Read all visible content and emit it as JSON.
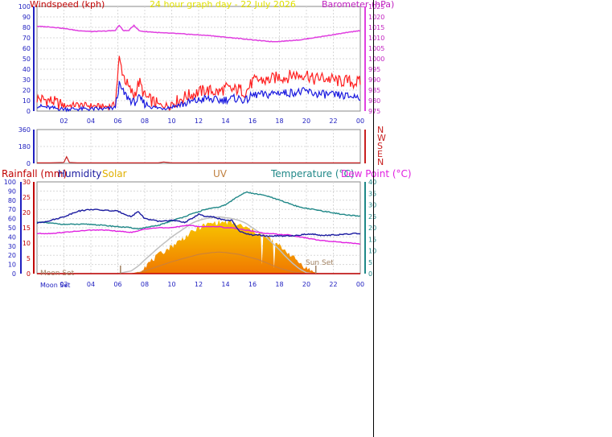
{
  "header": {
    "title": "24 hour graph day - 22 July 2026",
    "windspeed_label": "Windspeed (kph)",
    "barometer_label": "Barometer (hPa)"
  },
  "colors": {
    "wind_gust": "#ff2020",
    "wind_avg": "#1a1adf",
    "barometer": "#e040e0",
    "rainfall": "#c00000",
    "humidity": "#1a1aa0",
    "solar": "#f0c000",
    "uv": "#c88040",
    "temperature": "#208888",
    "dewpoint": "#e020e0",
    "axis_blue": "#2020c0",
    "direction": "#c82020"
  },
  "bottom_legend": {
    "rainfall": "Rainfall (mm)",
    "humidity": "Humidity",
    "solar": "Solar",
    "uv": "UV",
    "temperature": "Temperature (°C)",
    "dewpoint": "Dew Point (°C)"
  },
  "annotations": {
    "moon_set": "Moon Set",
    "sun_set": "Sun Set",
    "moon_set_axis": "Moon Set"
  },
  "direction_labels": [
    "N",
    "W",
    "S",
    "E",
    "N"
  ],
  "chart_data": [
    {
      "type": "line",
      "name": "wind-and-pressure",
      "x_hours": [
        0,
        1,
        2,
        3,
        4,
        5,
        5.8,
        6.1,
        6.4,
        6.8,
        7.2,
        7.6,
        8,
        8.5,
        9,
        9.5,
        10,
        10.5,
        11,
        11.5,
        12,
        12.5,
        13,
        13.5,
        14,
        14.5,
        15,
        15.5,
        16,
        16.5,
        17,
        17.5,
        18,
        18.5,
        19,
        19.5,
        20,
        20.5,
        21,
        21.5,
        22,
        22.5,
        23,
        23.5,
        24
      ],
      "x_tick_labels": [
        "02",
        "04",
        "06",
        "08",
        "10",
        "12",
        "14",
        "16",
        "18",
        "20",
        "22",
        "00"
      ],
      "y_left_ticks": [
        0,
        10,
        20,
        30,
        40,
        50,
        60,
        70,
        80,
        90,
        100
      ],
      "y_left_range": [
        0,
        100
      ],
      "y_right_ticks": [
        975,
        980,
        985,
        990,
        995,
        1000,
        1005,
        1010,
        1015,
        1020,
        1025
      ],
      "y_right_range": [
        975,
        1025
      ],
      "series": [
        {
          "name": "gust",
          "values": [
            12,
            10,
            5,
            6,
            5,
            4,
            6,
            50,
            35,
            22,
            15,
            28,
            14,
            10,
            6,
            5,
            8,
            10,
            14,
            16,
            18,
            20,
            19,
            18,
            22,
            20,
            21,
            18,
            28,
            30,
            29,
            31,
            33,
            32,
            35,
            34,
            36,
            30,
            32,
            31,
            30,
            28,
            29,
            27,
            28
          ]
        },
        {
          "name": "average",
          "values": [
            5,
            3,
            2,
            2,
            2,
            2,
            3,
            25,
            18,
            12,
            8,
            12,
            7,
            4,
            3,
            3,
            4,
            6,
            7,
            9,
            10,
            12,
            11,
            10,
            11,
            12,
            12,
            10,
            15,
            16,
            15,
            17,
            18,
            17,
            18,
            18,
            19,
            17,
            16,
            16,
            15,
            15,
            14,
            14,
            14
          ]
        },
        {
          "name": "barometer",
          "values": [
            1015.5,
            1015.2,
            1014.5,
            1013.5,
            1013,
            1013.2,
            1013.5,
            1016,
            1013.5,
            1013.4,
            1016,
            1013.3,
            1013,
            1012.8,
            1012.5,
            1012.3,
            1012.2,
            1012,
            1011.8,
            1011.6,
            1011.4,
            1011.2,
            1011,
            1010.6,
            1010.3,
            1010,
            1009.7,
            1009.4,
            1009,
            1008.7,
            1008.4,
            1008.2,
            1008.3,
            1008.5,
            1008.8,
            1009,
            1009.5,
            1010,
            1010.5,
            1011,
            1011.5,
            1012,
            1012.5,
            1013,
            1013.5
          ]
        }
      ]
    },
    {
      "type": "line",
      "name": "wind-direction",
      "y_ticks": [
        0,
        180,
        360
      ],
      "y_range": [
        0,
        360
      ],
      "x_hours": [
        0,
        1,
        2,
        2.2,
        2.4,
        3,
        6,
        9,
        9.4,
        10,
        12,
        18,
        24
      ],
      "values": [
        5,
        5,
        10,
        70,
        10,
        5,
        5,
        5,
        15,
        5,
        5,
        5,
        5
      ]
    },
    {
      "type": "area",
      "name": "weather",
      "x_tick_labels": [
        "02",
        "04",
        "06",
        "08",
        "10",
        "12",
        "14",
        "16",
        "18",
        "20",
        "22",
        "00"
      ],
      "y_left_ticks": [
        0,
        10,
        20,
        30,
        40,
        50,
        60,
        70,
        80,
        90,
        100
      ],
      "y_left_range": [
        0,
        100
      ],
      "y_rainfall_ticks": [
        0,
        5,
        10,
        15,
        20,
        25,
        30
      ],
      "y_rainfall_range": [
        0,
        30
      ],
      "y_right_ticks": [
        0,
        5,
        10,
        15,
        20,
        25,
        30,
        35,
        40
      ],
      "y_right_range": [
        0,
        40
      ],
      "x_hours": [
        0,
        1,
        2,
        3,
        4,
        5,
        6,
        7,
        7.5,
        8,
        9,
        10,
        11,
        11.5,
        12,
        12.5,
        13,
        13.5,
        14,
        14.5,
        15,
        15.5,
        16,
        16.5,
        17,
        17.5,
        18,
        18.5,
        19,
        19.5,
        20,
        20.5,
        21,
        22,
        23,
        24
      ],
      "series": [
        {
          "name": "humidity",
          "values": [
            55,
            58,
            62,
            68,
            70,
            69,
            68,
            62,
            68,
            60,
            57,
            58,
            56,
            60,
            65,
            62,
            62,
            60,
            58,
            58,
            46,
            44,
            42,
            42,
            41,
            41,
            41,
            41,
            41,
            42,
            43,
            43,
            42,
            42,
            43,
            44
          ]
        },
        {
          "name": "temperature",
          "values": [
            22.5,
            22,
            21.5,
            21.5,
            21.5,
            21,
            20.5,
            20,
            19.5,
            20,
            21,
            23,
            25,
            26,
            27,
            28,
            28.5,
            29,
            30,
            32,
            34,
            35.5,
            35,
            34.5,
            34,
            33,
            32,
            31,
            30,
            29,
            28.5,
            28,
            27.5,
            26.5,
            25.5,
            25
          ]
        },
        {
          "name": "dewpoint",
          "values": [
            17.5,
            17.5,
            18,
            18.5,
            19,
            19,
            18.5,
            18,
            18.5,
            19.5,
            20,
            20,
            21,
            21,
            20.5,
            20.5,
            20.5,
            20.5,
            20,
            20,
            19.5,
            19,
            18.5,
            18,
            17.5,
            17.5,
            17,
            17,
            16.5,
            16,
            15.5,
            15,
            14.5,
            14,
            13.5,
            13
          ]
        },
        {
          "name": "solar",
          "values": [
            0,
            0,
            0,
            0,
            0,
            0,
            0,
            0,
            2,
            8,
            20,
            30,
            40,
            45,
            50,
            53,
            55,
            56,
            56,
            55,
            53,
            50,
            47,
            44,
            40,
            36,
            30,
            25,
            18,
            12,
            6,
            2,
            0,
            0,
            0,
            0
          ]
        },
        {
          "name": "solar_max",
          "values": [
            0,
            0,
            0,
            0,
            0,
            0,
            0,
            3,
            8,
            15,
            28,
            40,
            50,
            55,
            58,
            60,
            61,
            62,
            61,
            60,
            58,
            55,
            50,
            45,
            40,
            33,
            26,
            18,
            11,
            5,
            1,
            0,
            0,
            0,
            0,
            0
          ]
        },
        {
          "name": "uv",
          "values": [
            0,
            0,
            0,
            0,
            0,
            0,
            0,
            0,
            1,
            3,
            8,
            13,
            17,
            19,
            21,
            22,
            23,
            23.5,
            23,
            22,
            21,
            19,
            17,
            15,
            12,
            9,
            6,
            4,
            2,
            1,
            0,
            0,
            0,
            0,
            0,
            0
          ]
        },
        {
          "name": "rainfall",
          "values": [
            0,
            0,
            0,
            0,
            0,
            0,
            0,
            0,
            0,
            0,
            0,
            0,
            0,
            0,
            0,
            0,
            0,
            0,
            0,
            0,
            0,
            0,
            0,
            0,
            0,
            0,
            0,
            0,
            0,
            0,
            0,
            0,
            0,
            0,
            0,
            0
          ]
        }
      ]
    }
  ]
}
